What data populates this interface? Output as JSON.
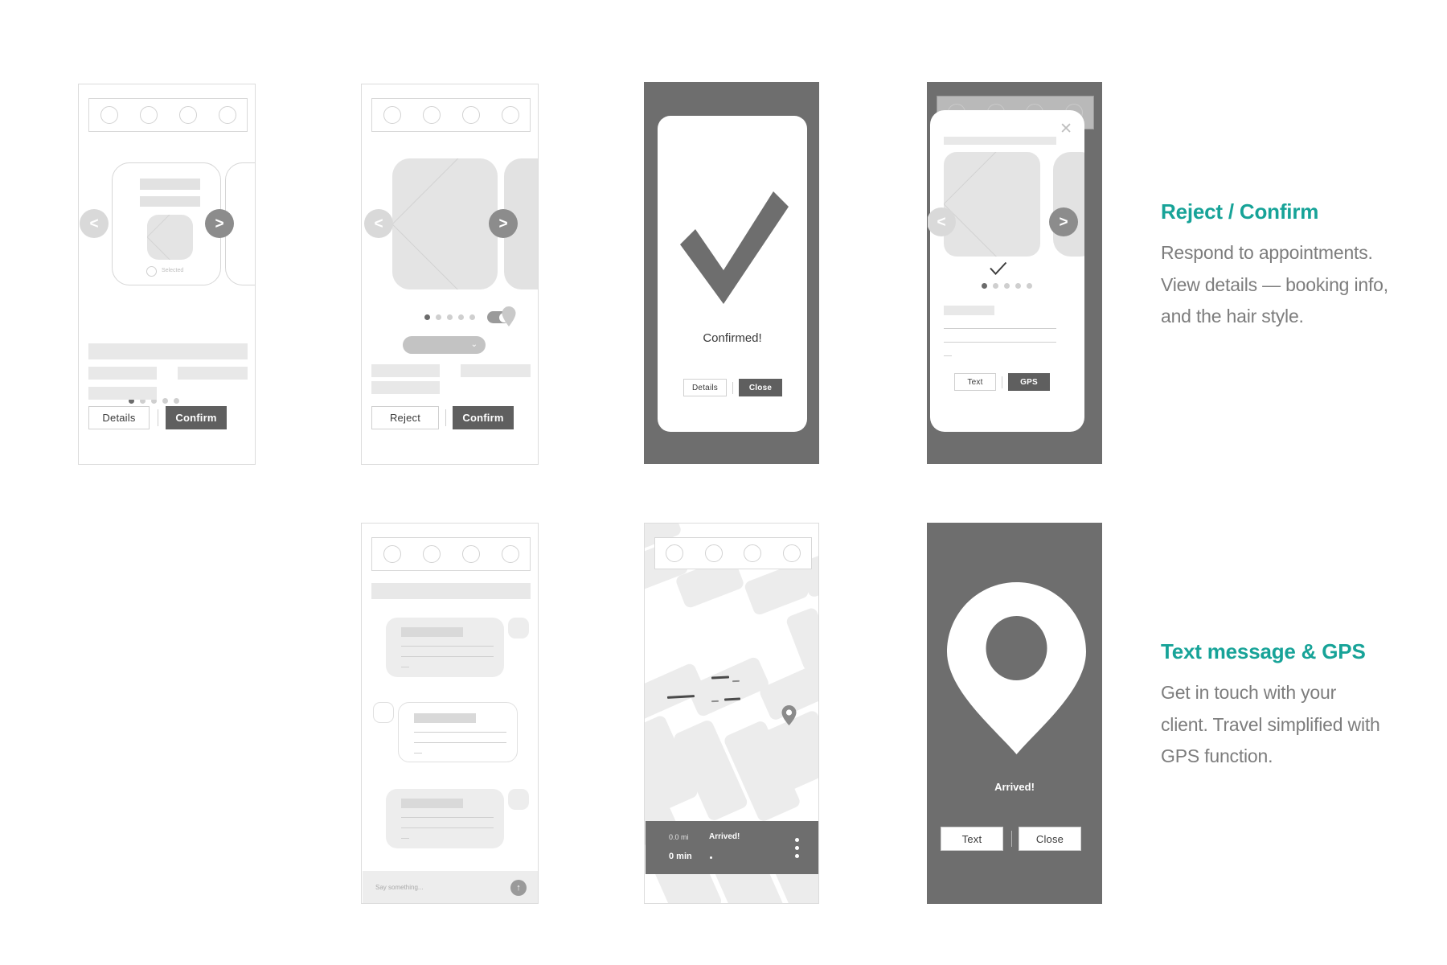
{
  "theme": {
    "accent": "#17a398",
    "body_text": "#7d7d7d",
    "dark_panel": "#6e6e6e",
    "button_filled": "#5f5f5f",
    "placeholder_grey": "#e8e8e8",
    "background": "#ffffff"
  },
  "screens": {
    "booking_select": {
      "name": "Booking selection",
      "card_radio_label": "Selected",
      "prev_arrow": "<",
      "next_arrow": ">",
      "dots": {
        "count": 5,
        "active_index": 0
      },
      "buttons": {
        "secondary": "Details",
        "primary": "Confirm"
      }
    },
    "booking_respond": {
      "name": "Booking respond",
      "prev_arrow": "<",
      "next_arrow": ">",
      "dots": {
        "count": 5,
        "active_index": 0
      },
      "toggle_state": "on",
      "map_pin_icon": "map-pin-icon",
      "dropdown_chevron": "⌄",
      "buttons": {
        "secondary": "Reject",
        "primary": "Confirm"
      }
    },
    "confirmed": {
      "name": "Confirmation success",
      "check_icon": "checkmark-icon",
      "title": "Confirmed!",
      "buttons": {
        "secondary": "Details",
        "primary": "Close"
      }
    },
    "details_modal": {
      "name": "Appointment details modal",
      "close_icon": "close-icon",
      "check_icon": "checkmark-icon",
      "prev_arrow": "<",
      "next_arrow": ">",
      "dots": {
        "count": 5,
        "active_index": 0
      },
      "buttons": {
        "secondary": "Text",
        "primary": "GPS"
      }
    },
    "chat": {
      "name": "Text message thread",
      "input_placeholder": "Say something...",
      "send_icon": "send-arrow-up-icon",
      "messages": [
        {
          "side": "right",
          "style": "grey"
        },
        {
          "side": "left",
          "style": "white"
        },
        {
          "side": "right",
          "style": "grey"
        }
      ]
    },
    "map": {
      "name": "GPS navigation map",
      "pin_icon": "map-pin-icon",
      "distance": "0.0 mi",
      "status": "Arrived!",
      "eta": "0 min",
      "menu_icon": "kebab-menu-icon"
    },
    "arrived": {
      "name": "Arrived confirmation",
      "pin_icon": "map-pin-icon",
      "title": "Arrived!",
      "buttons": {
        "secondary": "Text",
        "primary": "Close"
      }
    }
  },
  "annotations": [
    {
      "heading": "Reject / Confirm",
      "body": "Respond to appointments. View details — booking info, and the hair style.",
      "lines": [
        "Respond to appointments.",
        "View details — booking info,",
        "and the hair style."
      ]
    },
    {
      "heading": "Text message & GPS",
      "body": "Get in touch with your client. Travel simplified with GPS function.",
      "lines": [
        "Get in touch with your",
        "client. Travel simplified with",
        "GPS function."
      ]
    }
  ]
}
